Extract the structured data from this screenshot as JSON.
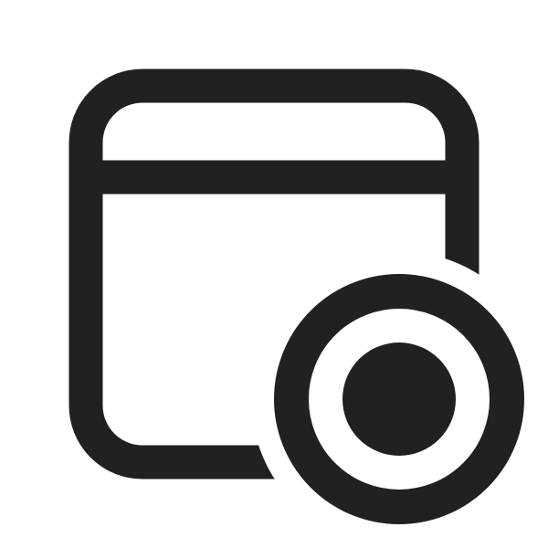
{
  "icon": {
    "name": "window-record-icon",
    "parts": [
      "window-frame-icon",
      "window-title-bar-divider",
      "record-indicator-icon"
    ]
  },
  "colors": {
    "stroke": "#212121",
    "background": "#ffffff"
  }
}
